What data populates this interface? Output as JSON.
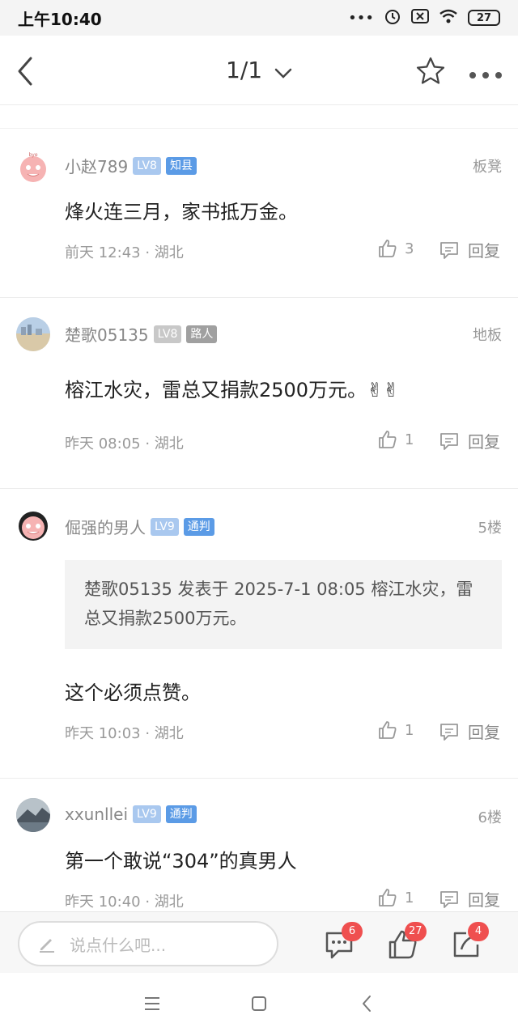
{
  "status_bar": {
    "time": "上午10:40",
    "battery": "27"
  },
  "header": {
    "page_indicator": "1/1"
  },
  "comments": [
    {
      "username": "小赵789",
      "level": "LV8",
      "title": "知县",
      "floor": "板凳",
      "content": "烽火连三月，家书抵万金。",
      "meta": "前天 12:43 · 湖北",
      "likes": "3",
      "reply_label": "回复"
    },
    {
      "username": "楚歌05135",
      "level": "LV8",
      "title": "路人",
      "floor": "地板",
      "content": "榕江水灾，雷总又捐款2500万元。✌✌",
      "meta": "昨天 08:05 · 湖北",
      "likes": "1",
      "reply_label": "回复"
    },
    {
      "username": "倔强的男人",
      "level": "LV9",
      "title": "通判",
      "floor": "5楼",
      "quote": "楚歌05135 发表于 2025-7-1 08:05 榕江水灾，雷总又捐款2500万元。",
      "content": "这个必须点赞。",
      "meta": "昨天 10:03 · 湖北",
      "likes": "1",
      "reply_label": "回复"
    },
    {
      "username": "xxunllei",
      "level": "LV9",
      "title": "通判",
      "floor": "6楼",
      "content": "第一个敢说“304”的真男人",
      "meta": "昨天 10:40 · 湖北",
      "likes": "1",
      "reply_label": "回复"
    }
  ],
  "bottom_bar": {
    "input_placeholder": "说点什么吧...",
    "comment_count": "6",
    "like_count": "27",
    "share_count": "4"
  },
  "colors": {
    "level_badge": "#a9c8ef",
    "level_badge_gray": "#c8c8c8",
    "title_badge_blue": "#5b9be6",
    "title_badge_gray": "#a0a0a0",
    "notification_red": "#ef4f4f"
  }
}
